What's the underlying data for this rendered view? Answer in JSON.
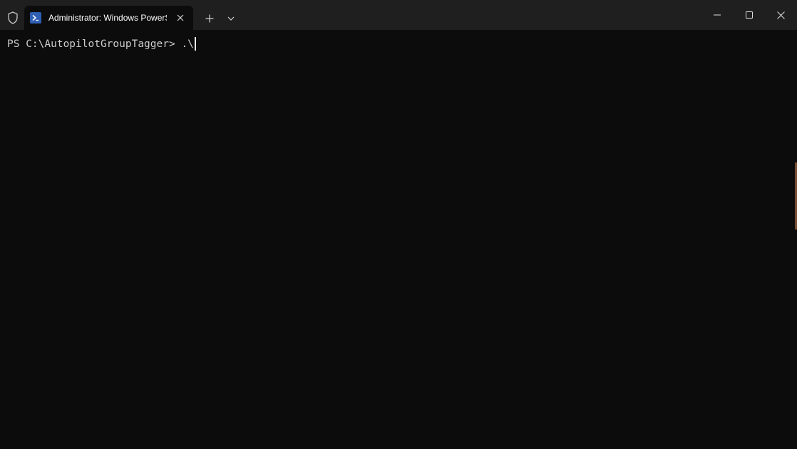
{
  "window": {
    "tab_title": "Administrator: Windows PowerShell",
    "new_tab_icon": "plus-icon",
    "dropdown_icon": "chevron-down-icon",
    "controls": [
      "minimize-icon",
      "maximize-icon",
      "close-icon"
    ]
  },
  "terminal": {
    "prompt": "PS C:\\AutopilotGroupTagger> ",
    "input": ".\\"
  },
  "colors": {
    "titlebar": "#1f1f1f",
    "background": "#0c0c0c",
    "text": "#cccccc",
    "tab_icon": "#2f5fb4"
  }
}
